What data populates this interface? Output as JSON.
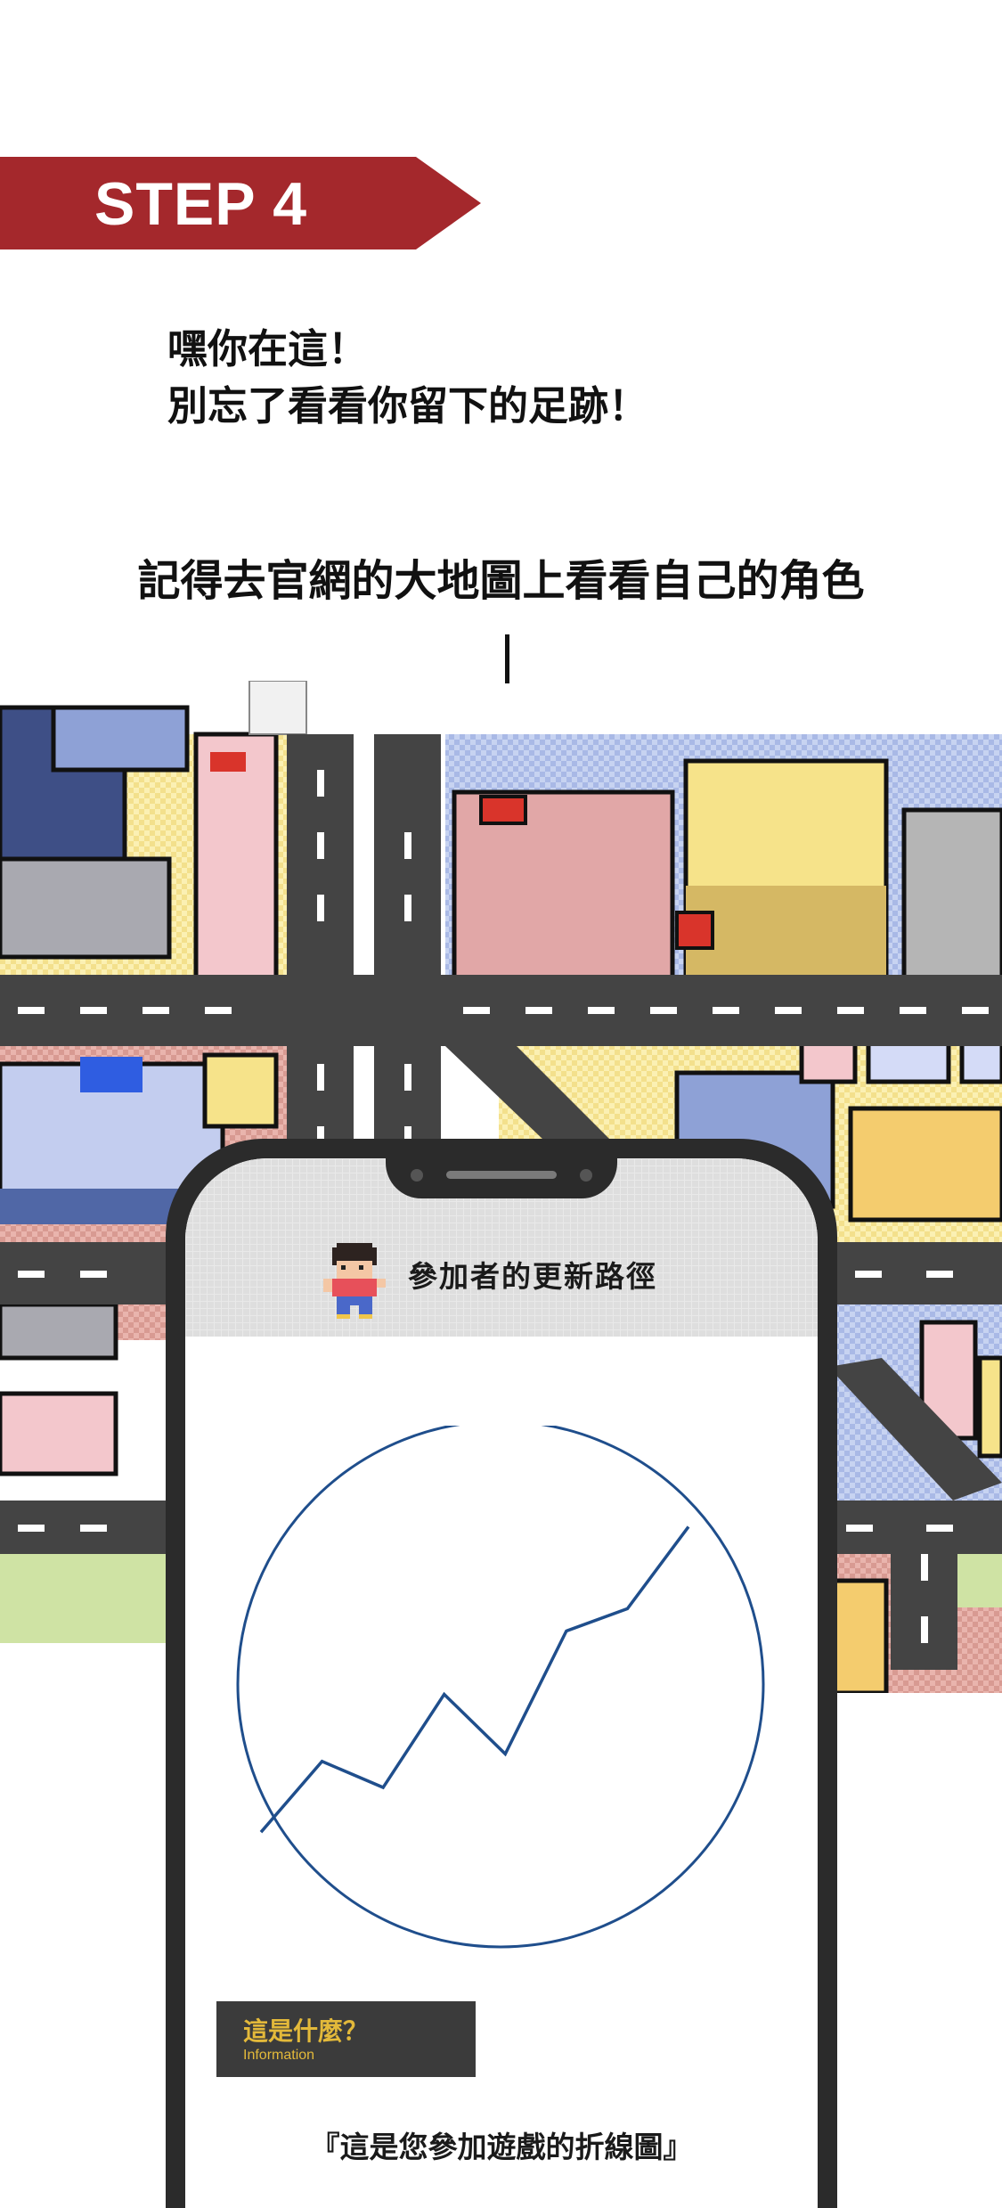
{
  "step": {
    "label": "STEP 4"
  },
  "intro": {
    "line1": "嘿你在這！",
    "line2": "別忘了看看你留下的足跡！"
  },
  "reminder": "記得去官網的大地圖上看看自己的角色",
  "phone": {
    "title": "參加者的更新路徑"
  },
  "chart_data": {
    "type": "line",
    "title": "",
    "xlabel": "",
    "ylabel": "",
    "x": [
      1,
      2,
      3,
      4,
      5,
      6,
      7,
      8
    ],
    "values": [
      1,
      2.9,
      2.2,
      4.7,
      3.1,
      6.4,
      7.0,
      9.2
    ],
    "ylim": [
      0,
      10
    ],
    "color": "#1f4e8c"
  },
  "info": {
    "title": "這是什麼？",
    "subtitle": "Information"
  },
  "caption": "『這是您參加遊戲的折線圖』"
}
